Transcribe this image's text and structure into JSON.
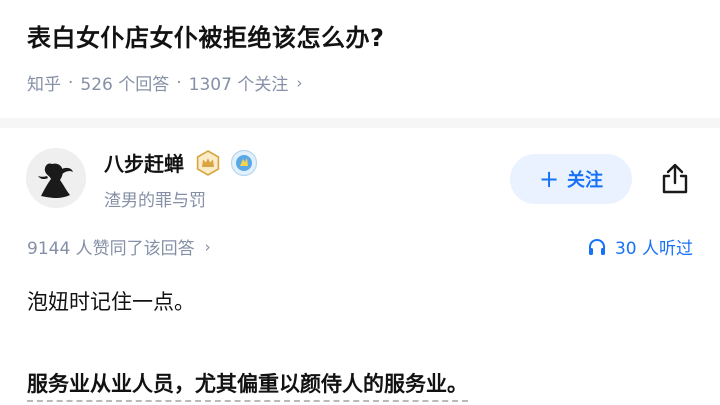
{
  "question": {
    "title": "表白女仆店女仆被拒绝该怎么办?",
    "source": "知乎",
    "answers": "526 个回答",
    "followers": "1307 个关注"
  },
  "author": {
    "name": "八步赶蝉",
    "bio": "渣男的罪与罚",
    "follow_label": "关注"
  },
  "answer": {
    "upvote_text": "9144 人赞同了该回答",
    "listen_text": "30 人听过",
    "paragraphs": [
      "泡妞时记住一点。",
      "服务业从业人员，尤其偏重以颜侍人的服务业。"
    ]
  },
  "colors": {
    "accent": "#1772f6",
    "follow_bg": "#eaf1ff",
    "meta_gray": "#8590a6",
    "text": "#121212",
    "badge_gold": "#d9a441"
  },
  "icons": {
    "follow": "plus-icon",
    "share": "share-icon",
    "listen": "headphones-icon",
    "badge1": "crown-badge-icon",
    "badge2": "creator-badge-icon"
  }
}
